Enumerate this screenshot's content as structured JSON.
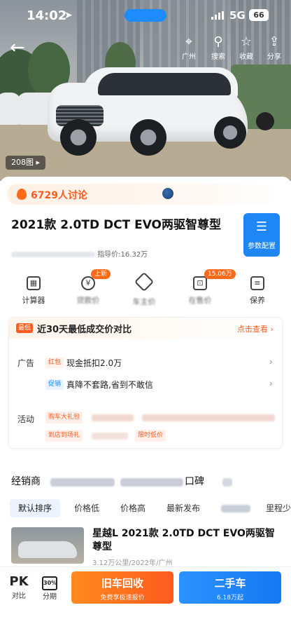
{
  "status_bar": {
    "time": "14:02",
    "network": "5G",
    "battery": "66"
  },
  "top_nav": {
    "items": [
      {
        "icon": "location-pin-icon",
        "label": "广州"
      },
      {
        "icon": "search-icon",
        "label": "搜索"
      },
      {
        "icon": "star-icon",
        "label": "收藏"
      },
      {
        "icon": "share-icon",
        "label": "分享"
      }
    ]
  },
  "gallery": {
    "photo_count": "208图"
  },
  "discussion": {
    "text": "6729人讨论"
  },
  "car": {
    "title": "2021款 2.0TD DCT EVO两驱智尊型",
    "guide_price": "指导价:16.32万",
    "param_button": "参数配置"
  },
  "tools": [
    {
      "label": "计算器",
      "badge": "",
      "blurred": false
    },
    {
      "label": "贷款价",
      "badge": "上新",
      "blurred": true
    },
    {
      "label": "车主价",
      "badge": "",
      "blurred": true
    },
    {
      "label": "在售价",
      "badge": "15.06万",
      "blurred": true
    },
    {
      "label": "保养",
      "badge": "",
      "blurred": false
    }
  ],
  "deal_card": {
    "tag": "最低",
    "title": "近30天最低成交价对比",
    "more": "点击查看",
    "ad_label": "广告",
    "offers": [
      {
        "tag": "红包",
        "text": "现金抵扣2.0万"
      },
      {
        "tag": "促销",
        "text": "真降不套路,省到不敢信"
      }
    ],
    "activity_label": "活动",
    "activity_tags": [
      "购车大礼包",
      "到店到场礼",
      "限时低价"
    ]
  },
  "dealers": {
    "tabs": [
      "经销商",
      "口碑"
    ],
    "sorts": [
      "默认排序",
      "价格低",
      "价格高",
      "最新发布",
      "里程少"
    ]
  },
  "listing": {
    "title": "星越L 2021款 2.0TD DCT EVO两驱智尊型",
    "meta": "3.12万公里/2022年/广州"
  },
  "bottom_bar": {
    "pk_label": "对比",
    "loan_icon": "30%",
    "loan_label": "分期",
    "trade_in_title": "旧车回收",
    "trade_in_sub": "免费享极速报价",
    "used_car_title": "二手车",
    "used_car_sub": "6.18万起"
  },
  "colors": {
    "accent_orange": "#ff5a1f",
    "accent_blue": "#1f87f5"
  }
}
